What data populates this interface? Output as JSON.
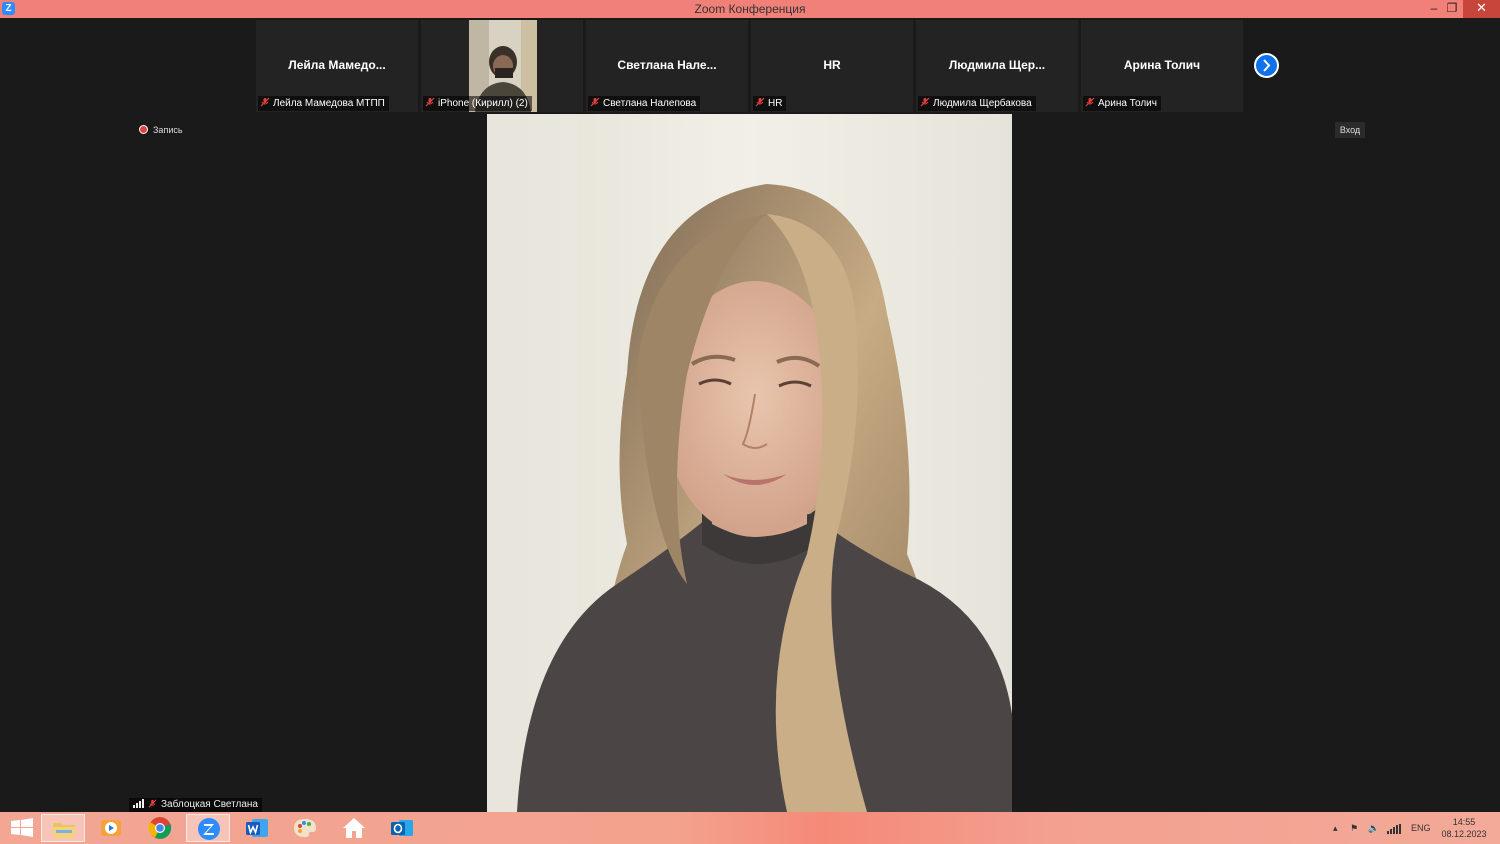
{
  "window": {
    "title": "Zoom Конференция",
    "min_glyph": "–",
    "max_glyph": "❐",
    "close_glyph": "✕",
    "app_glyph": "Z"
  },
  "participants": [
    {
      "name": "Лейла  Мамедо...",
      "label": "Лейла Мамедова МТПП"
    },
    {
      "name": "",
      "label": "iPhone (Кирилл) (2)"
    },
    {
      "name": "Светлана  Нале...",
      "label": "Светлана Налепова"
    },
    {
      "name": "HR",
      "label": "HR"
    },
    {
      "name": "Людмила  Щер...",
      "label": "Людмила Щербакова"
    },
    {
      "name": "Арина Толич",
      "label": "Арина Толич"
    }
  ],
  "recording": {
    "label": "Запись"
  },
  "enter_button": {
    "label": "Вход"
  },
  "active_speaker": {
    "label": "Заблоцкая Светлана"
  },
  "tray": {
    "lang": "ENG",
    "time": "14:55",
    "date": "08.12.2023"
  },
  "colors": {
    "title_bar": "#f08078",
    "zoom_blue": "#0e72ed",
    "mic_muted": "#e04040"
  }
}
